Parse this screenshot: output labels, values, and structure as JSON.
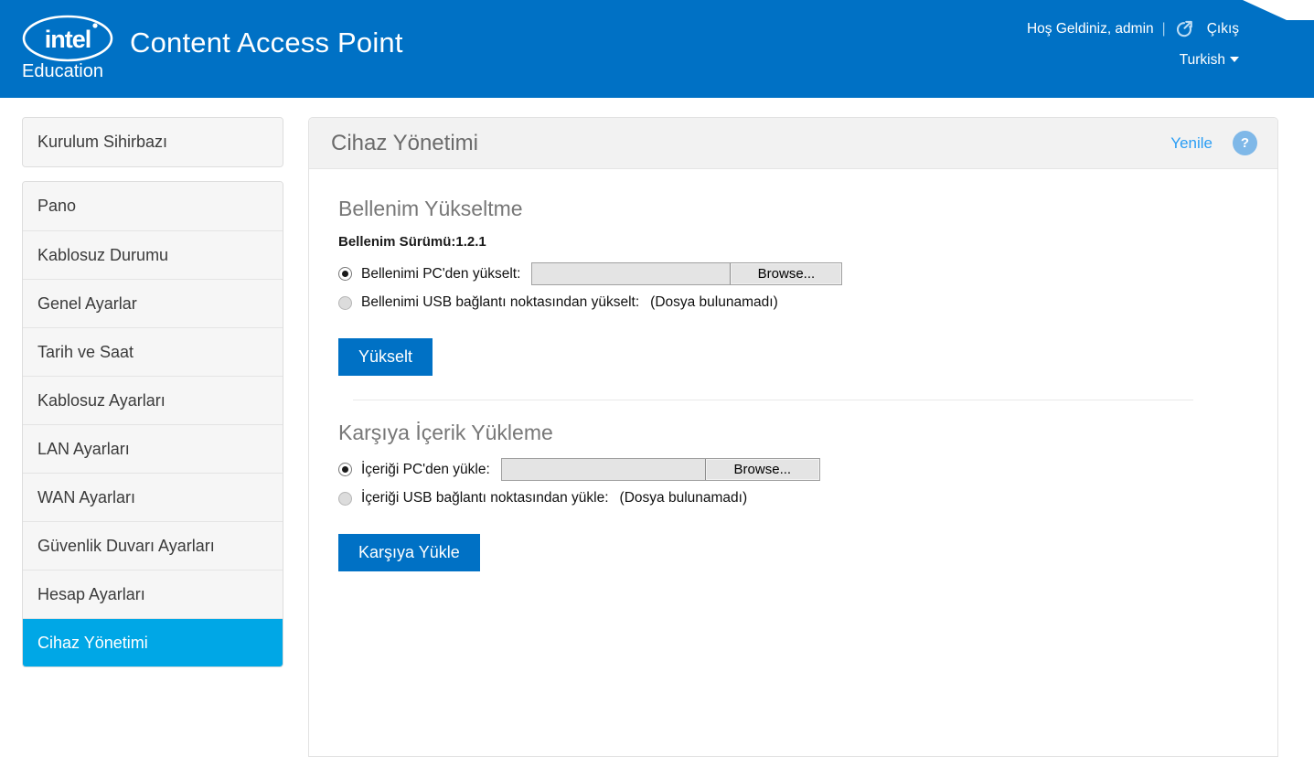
{
  "header": {
    "logo_alt": "intel Education",
    "logo_word": "intel",
    "logo_sub": "Education",
    "app_title": "Content Access Point",
    "welcome": "Hoş Geldiniz, admin",
    "separator": "|",
    "logout_icon": "logout-icon",
    "logout_label": "Çıkış",
    "language": "Turkish",
    "brand_color": "#0071c5"
  },
  "sidebar": {
    "wizard": {
      "label": "Kurulum Sihirbazı"
    },
    "items": [
      {
        "label": "Pano",
        "active": false
      },
      {
        "label": "Kablosuz Durumu",
        "active": false
      },
      {
        "label": "Genel Ayarlar",
        "active": false
      },
      {
        "label": "Tarih ve Saat",
        "active": false
      },
      {
        "label": "Kablosuz Ayarları",
        "active": false
      },
      {
        "label": "LAN Ayarları",
        "active": false
      },
      {
        "label": "WAN Ayarları",
        "active": false
      },
      {
        "label": "Güvenlik Duvarı Ayarları",
        "active": false
      },
      {
        "label": "Hesap Ayarları",
        "active": false
      },
      {
        "label": "Cihaz Yönetimi",
        "active": true
      }
    ],
    "active_color": "#00a7e6"
  },
  "panel": {
    "title": "Cihaz Yönetimi",
    "refresh_label": "Yenile",
    "help_label": "?",
    "refresh_color": "#2a9df4"
  },
  "firmware": {
    "section_title": "Bellenim Yükseltme",
    "version_line": "Bellenim Sürümü:1.2.1",
    "pc_option_label": "Bellenimi PC'den yükselt:",
    "pc_option_selected": true,
    "file_value": "",
    "browse_label": "Browse...",
    "usb_option_label": "Bellenimi USB bağlantı noktasından yükselt:",
    "usb_option_selected": false,
    "usb_status": "(Dosya bulunamadı)",
    "submit_label": "Yükselt"
  },
  "content_upload": {
    "section_title": "Karşıya İçerik Yükleme",
    "pc_option_label": "İçeriği PC'den yükle:",
    "pc_option_selected": true,
    "file_value": "",
    "browse_label": "Browse...",
    "usb_option_label": "İçeriği USB bağlantı noktasından yükle:",
    "usb_option_selected": false,
    "usb_status": "(Dosya bulunamadı)",
    "submit_label": "Karşıya Yükle"
  }
}
